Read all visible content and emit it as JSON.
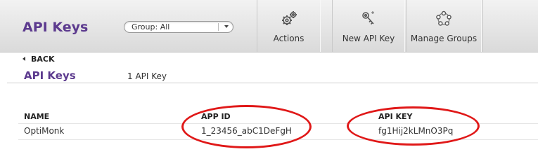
{
  "header": {
    "title": "API Keys",
    "group_select": {
      "value": "Group: All"
    },
    "toolbar": [
      {
        "label": "Actions",
        "icon": "gears-icon"
      },
      {
        "label": "New API Key",
        "icon": "key-icon"
      },
      {
        "label": "Manage Groups",
        "icon": "group-circle-icon"
      }
    ]
  },
  "nav": {
    "back_label": "BACK"
  },
  "section": {
    "title": "API Keys",
    "count_label": "1 API Key"
  },
  "table": {
    "columns": [
      "NAME",
      "APP ID",
      "API KEY"
    ],
    "rows": [
      {
        "name": "OptiMonk",
        "app_id": "1_23456_abC1DeFgH",
        "api_key": "fg1Hij2kLMnO3Pq"
      }
    ]
  },
  "colors": {
    "brand": "#5c3a8e",
    "highlight": "#e01818"
  }
}
